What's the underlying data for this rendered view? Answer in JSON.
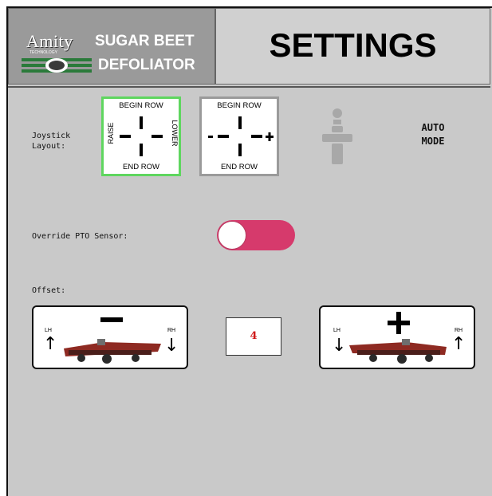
{
  "header": {
    "logo_text": "Amity",
    "logo_sub": "TECHNOLOGY",
    "brand_line1": "SUGAR BEET",
    "brand_line2": "DEFOLIATOR",
    "page_title": "SETTINGS"
  },
  "joystick": {
    "label_line1": "Joystick",
    "label_line2": "Layout:",
    "layout_a": {
      "top": "BEGIN ROW",
      "bottom": "END ROW",
      "left": "RAISE",
      "right": "LOWER"
    },
    "layout_b": {
      "top": "BEGIN ROW",
      "bottom": "END ROW",
      "left": "-",
      "right": "+"
    },
    "auto_mode_line1": "AUTO",
    "auto_mode_line2": "MODE"
  },
  "pto": {
    "label": "Override PTO Sensor:",
    "toggle_on": true,
    "toggle_color": "#d63a6c"
  },
  "offset": {
    "label": "Offset:",
    "value": "4",
    "minus_button": {
      "left_tag": "LH",
      "right_tag": "RH",
      "sign": "−"
    },
    "plus_button": {
      "left_tag": "LH",
      "right_tag": "RH",
      "sign": "+"
    }
  },
  "colors": {
    "selected_border": "#5fd65f",
    "unselected_border": "#9a9a9a",
    "value_red": "#d01a1a"
  }
}
